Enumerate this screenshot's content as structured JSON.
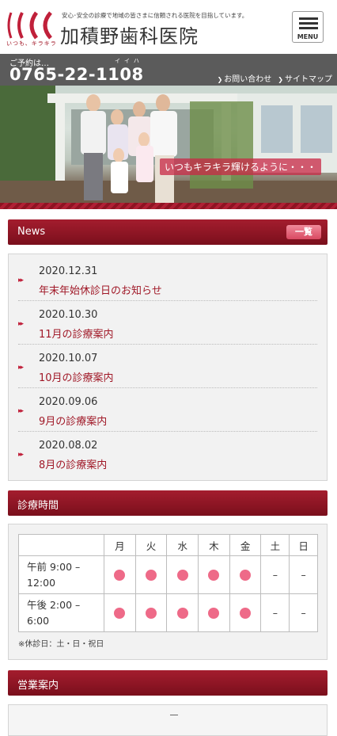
{
  "header": {
    "tagline": "安心･安全の診療で地域の皆さまに信頼される医院を目指しています。",
    "clinic_name": "加積野歯科医院",
    "logo_sub": "いつも、キラキラ",
    "menu_label": "MENU"
  },
  "phone_bar": {
    "reserve_label": "ご予約は…",
    "ruby": "イイハ",
    "phone": "0765-22-1108",
    "links": [
      "お問い合わせ",
      "サイトマップ"
    ]
  },
  "hero": {
    "caption": "いつもキラキラ輝けるように・・・"
  },
  "news": {
    "heading": "News",
    "all_button": "一覧",
    "items": [
      {
        "date": "2020.12.31",
        "title": "年末年始休診日のお知らせ"
      },
      {
        "date": "2020.10.30",
        "title": "11月の診療案内"
      },
      {
        "date": "2020.10.07",
        "title": "10月の診療案内"
      },
      {
        "date": "2020.09.06",
        "title": "9月の診療案内"
      },
      {
        "date": "2020.08.02",
        "title": "8月の診療案内"
      }
    ]
  },
  "hours": {
    "heading": "診療時間",
    "days": [
      "月",
      "火",
      "水",
      "木",
      "金",
      "土",
      "日"
    ],
    "rows": [
      {
        "time": "午前 9:00 – 12:00",
        "marks": [
          "●",
          "●",
          "●",
          "●",
          "●",
          "–",
          "–"
        ]
      },
      {
        "time": "午後 2:00 – 6:00",
        "marks": [
          "●",
          "●",
          "●",
          "●",
          "●",
          "–",
          "–"
        ]
      }
    ],
    "note": "※休診日：土・日・祝日"
  },
  "business": {
    "heading": "営業案内"
  },
  "colors": {
    "accent": "#8e1322",
    "dot": "#ee6a88",
    "title_red": "#a01827"
  }
}
